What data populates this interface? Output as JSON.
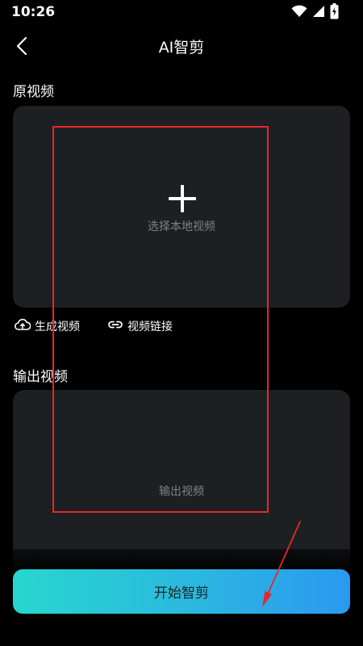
{
  "status_bar": {
    "time": "10:26",
    "icons": [
      "wifi-icon",
      "signal-icon",
      "battery-charging-icon"
    ]
  },
  "header": {
    "title": "AI智剪",
    "back_icon": "back-arrow-icon"
  },
  "source_section": {
    "label": "原视频",
    "upload_icon": "plus-icon",
    "select_text": "选择本地视频"
  },
  "actions": {
    "generate_label": "生成视频",
    "generate_icon": "cloud-upload-icon",
    "link_label": "视频链接",
    "link_icon": "link-icon"
  },
  "output_section": {
    "label": "输出视频",
    "placeholder_text": "输出视频"
  },
  "start_button": {
    "label": "开始智剪"
  },
  "colors": {
    "background": "#000000",
    "card": "#1c2022",
    "muted_text": "#7b8285",
    "button_gradient_start": "#27d7cf",
    "button_gradient_end": "#2b98f0",
    "annotation": "#e8262b"
  }
}
